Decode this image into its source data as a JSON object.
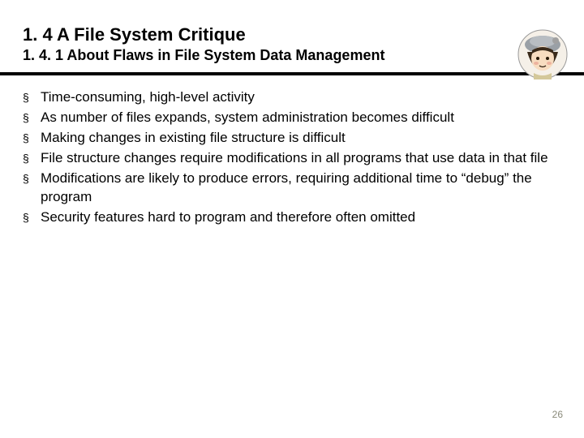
{
  "header": {
    "title": "1. 4 A File System Critique",
    "subtitle": "1. 4. 1 About Flaws in File System Data Management"
  },
  "bullets": [
    "Time-consuming, high-level activity",
    "As number of files expands, system administration becomes difficult",
    "Making changes in existing file structure is difficult",
    "File structure changes require modifications in all programs that use data in that file",
    "Modifications are likely to produce errors, requiring additional time to “debug” the program",
    "Security features hard to program and therefore often omitted"
  ],
  "bullet_marker": "§",
  "page_number": "26"
}
